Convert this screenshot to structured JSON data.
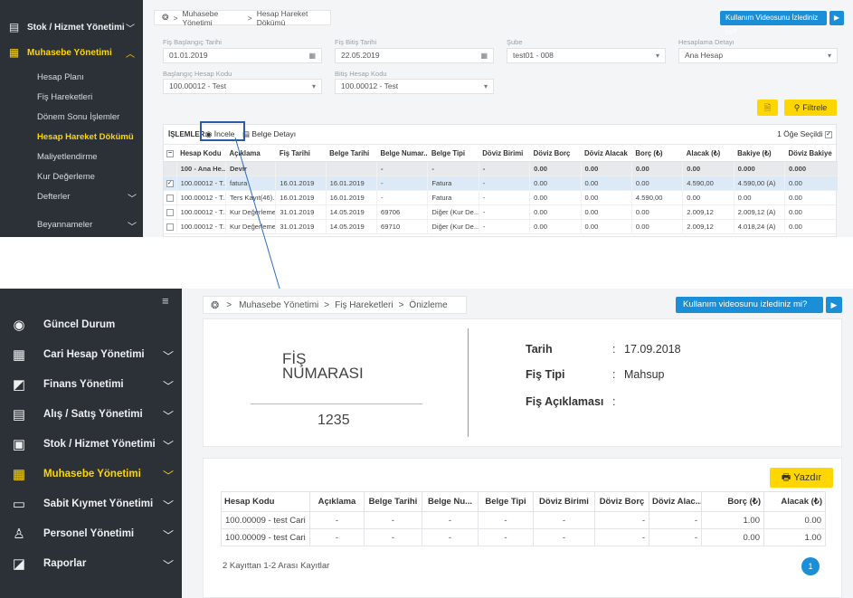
{
  "top": {
    "sidebar": {
      "items": [
        {
          "label": "Stok / Hizmet Yönetimi",
          "icon": "printer-icon"
        },
        {
          "label": "Muhasebe Yönetimi",
          "icon": "clipboard-icon"
        }
      ],
      "subitems": [
        "Hesap Planı",
        "Fiş Hareketleri",
        "Dönem Sonu İşlemler",
        "Hesap Hareket Dökümü",
        "Maliyetlendirme",
        "Kur Değerleme"
      ],
      "lower_items": [
        "Defterler",
        "Beyannameler"
      ]
    },
    "breadcrumb": {
      "sep": ">",
      "items": [
        "Muhasebe Yönetimi",
        "Hesap Hareket Dökümü"
      ]
    },
    "video_label": "Kullanım Videosunu İzlediniz mi?",
    "filters": {
      "fis_baslangic": {
        "label": "Fiş Başlangıç Tarihi",
        "value": "01.01.2019"
      },
      "fis_bitis": {
        "label": "Fiş Bitiş Tarihi",
        "value": "22.05.2019"
      },
      "sube": {
        "label": "Şube",
        "value": "test01 - 008"
      },
      "hesaplama": {
        "label": "Hesaplama Detayı",
        "value": "Ana Hesap"
      },
      "baslangic_kodu": {
        "label": "Başlangıç Hesap Kodu",
        "value": "100.00012 - Test"
      },
      "bitis_kodu": {
        "label": "Bitiş Hesap Kodu",
        "value": "100.00012 - Test"
      }
    },
    "filter_button": "Filtrele",
    "islemler": {
      "label": "İŞLEMLER:",
      "incele": "İncele",
      "belge": "Belge Detayı",
      "selected": "1 Öğe Seçildi"
    },
    "columns": [
      "Hesap Kodu",
      "Açıklama",
      "Fiş Tarihi",
      "Belge Tarihi",
      "Belge Numar...",
      "Belge Tipi",
      "Döviz Birimi",
      "Döviz Borç",
      "Döviz Alacak",
      "Borç (₺)",
      "Alacak (₺)",
      "Bakiye (₺)",
      "Döviz Bakiye"
    ],
    "rows": [
      {
        "type": "sum",
        "cells": [
          "100 - Ana He...",
          "Devir",
          "",
          "",
          "-",
          "-",
          "-",
          "0.00",
          "0.00",
          "0.00",
          "0.00",
          "0.000",
          "0.000"
        ]
      },
      {
        "type": "sel",
        "cells": [
          "100.00012 - T...",
          "fatura",
          "16.01.2019",
          "16.01.2019",
          "-",
          "Fatura",
          "-",
          "0.00",
          "0.00",
          "0.00",
          "4.590,00",
          "4.590,00 (A)",
          "0.00"
        ]
      },
      {
        "type": "",
        "cells": [
          "100.00012 - T...",
          "Ters Kayıt(46)...",
          "16.01.2019",
          "16.01.2019",
          "-",
          "Fatura",
          "-",
          "0.00",
          "0.00",
          "4.590,00",
          "0.00",
          "0.00",
          "0.00"
        ]
      },
      {
        "type": "",
        "cells": [
          "100.00012 - T...",
          "Kur Değerleme",
          "31.01.2019",
          "14.05.2019",
          "69706",
          "Diğer (Kur De...",
          "-",
          "0.00",
          "0.00",
          "0.00",
          "2.009,12",
          "2.009,12 (A)",
          "0.00"
        ]
      },
      {
        "type": "",
        "cells": [
          "100.00012 - T...",
          "Kur Değerleme",
          "31.01.2019",
          "14.05.2019",
          "69710",
          "Diğer (Kur De...",
          "-",
          "0.00",
          "0.00",
          "0.00",
          "2.009,12",
          "4.018,24 (A)",
          "0.00"
        ]
      }
    ]
  },
  "bottom": {
    "sidebar": {
      "items": [
        {
          "label": "Güncel Durum",
          "icon": "dashboard-icon",
          "chev": false
        },
        {
          "label": "Cari Hesap Yönetimi",
          "icon": "calculator-icon",
          "chev": true
        },
        {
          "label": "Finans Yönetimi",
          "icon": "finance-icon",
          "chev": true
        },
        {
          "label": "Alış / Satış Yönetimi",
          "icon": "invoice-icon",
          "chev": true
        },
        {
          "label": "Stok / Hizmet Yönetimi",
          "icon": "printer-icon",
          "chev": true
        },
        {
          "label": "Muhasebe Yönetimi",
          "icon": "clipboard-icon",
          "chev": true,
          "active": true
        },
        {
          "label": "Sabit Kıymet Yönetimi",
          "icon": "card-icon",
          "chev": true
        },
        {
          "label": "Personel Yönetimi",
          "icon": "person-icon",
          "chev": true
        },
        {
          "label": "Raporlar",
          "icon": "chart-icon",
          "chev": true
        }
      ]
    },
    "breadcrumb": {
      "sep": ">",
      "items": [
        "Muhasebe Yönetimi",
        "Fiş Hareketleri",
        "Önizleme"
      ]
    },
    "video_label": "Kullanım videosunu izlediniz mi?",
    "fis": {
      "title_line1": "FİŞ",
      "title_line2": "NUMARASI",
      "number": "1235"
    },
    "info": {
      "tarih_label": "Tarih",
      "tarih_value": "17.09.2018",
      "tip_label": "Fiş Tipi",
      "tip_value": "Mahsup",
      "aciklama_label": "Fiş Açıklaması",
      "colon": ":"
    },
    "print_button": "Yazdır",
    "columns": [
      "Hesap Kodu",
      "Açıklama",
      "Belge Tarihi",
      "Belge Nu...",
      "Belge Tipi",
      "Döviz Birimi",
      "Döviz Borç",
      "Döviz Alac...",
      "Borç (₺)",
      "Alacak (₺)"
    ],
    "rows": [
      [
        "100.00009 - test Cari",
        "-",
        "-",
        "-",
        "-",
        "-",
        "-",
        "-",
        "1.00",
        "0.00"
      ],
      [
        "100.00009 - test Cari",
        "-",
        "-",
        "-",
        "-",
        "-",
        "-",
        "-",
        "0.00",
        "1.00"
      ]
    ],
    "record_summary": "2 Kayıttan 1-2 Arası Kayıtlar",
    "page": "1"
  }
}
